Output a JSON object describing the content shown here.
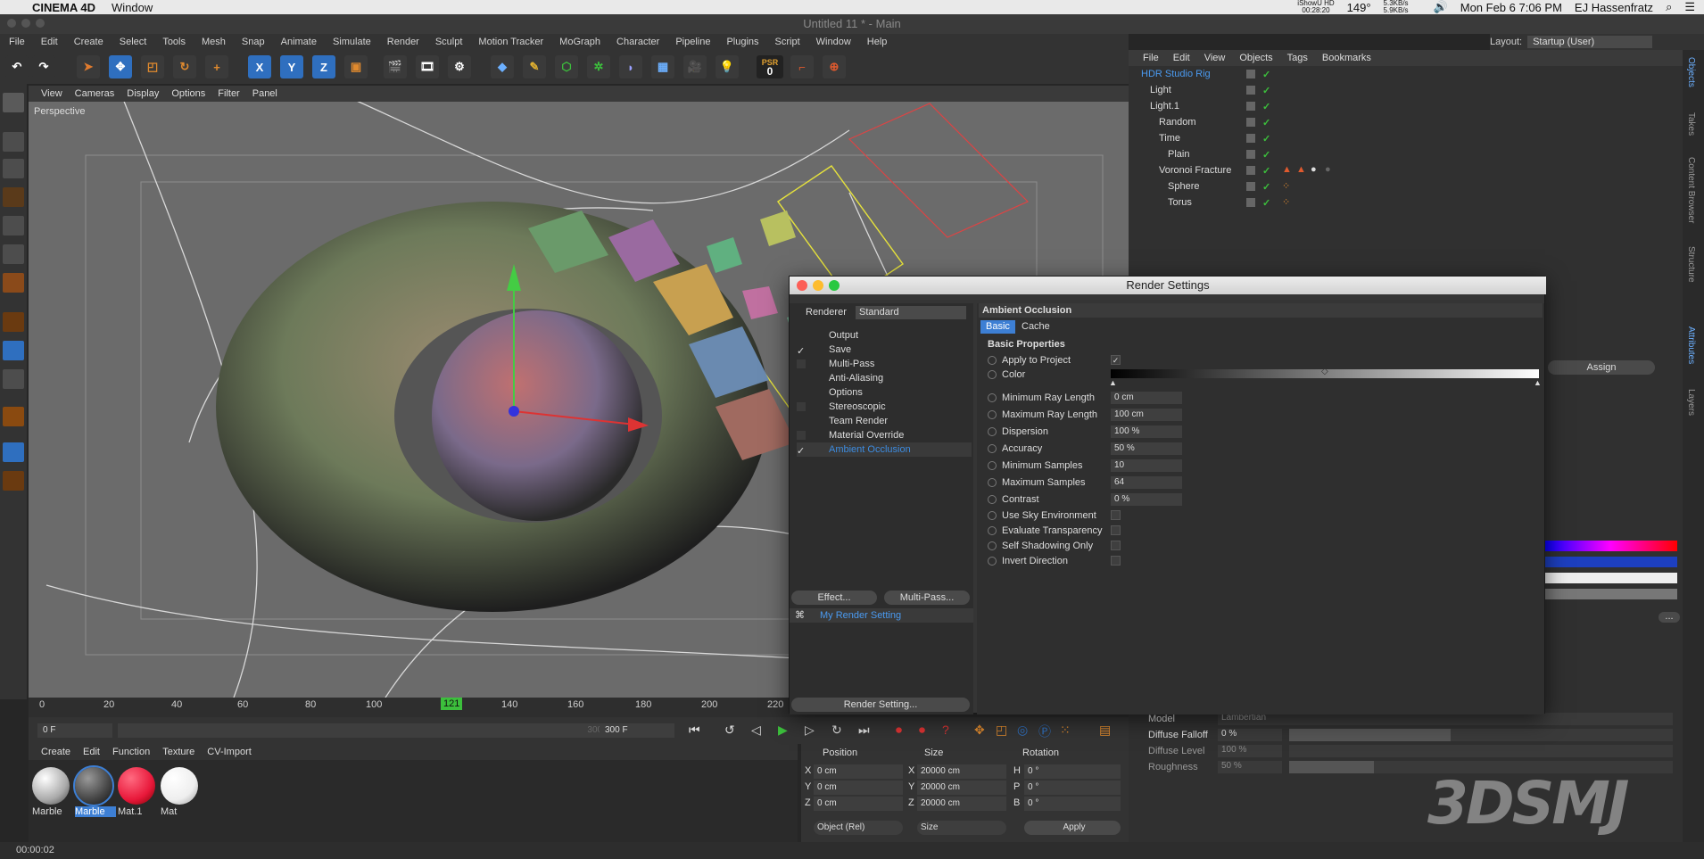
{
  "macbar": {
    "app_name": "CINEMA 4D",
    "window_menu": "Window",
    "ishowu": "iShowU HD",
    "rec_time": "00:28:20",
    "temp": "149°",
    "net_up": "5.3KB/s",
    "net_down": "5.9KB/s",
    "datetime": "Mon Feb 6  7:06 PM",
    "user": "EJ Hassenfratz"
  },
  "window_title": "Untitled 11 * - Main",
  "main_menu": [
    "File",
    "Edit",
    "Create",
    "Select",
    "Tools",
    "Mesh",
    "Snap",
    "Animate",
    "Simulate",
    "Render",
    "Sculpt",
    "Motion Tracker",
    "MoGraph",
    "Character",
    "Pipeline",
    "Plugins",
    "Script",
    "Window",
    "Help"
  ],
  "layout": {
    "label": "Layout:",
    "value": "Startup (User)"
  },
  "toolbar": {
    "x": "X",
    "y": "Y",
    "z": "Z",
    "psr_label": "PSR",
    "psr_value": "0"
  },
  "viewport": {
    "menu": [
      "View",
      "Cameras",
      "Display",
      "Options",
      "Filter",
      "Panel"
    ],
    "label": "Perspective"
  },
  "timeline": {
    "ticks": [
      "0",
      "20",
      "40",
      "60",
      "80",
      "100",
      "121",
      "140",
      "160",
      "180",
      "200",
      "220"
    ],
    "current_frame": "121",
    "start_field": "0 F",
    "end_field": "300 F",
    "slider_text": "300 F"
  },
  "materials": {
    "menu": [
      "Create",
      "Edit",
      "Function",
      "Texture",
      "CV-Import"
    ],
    "items": [
      {
        "label": "Marble",
        "color": "#d9d9d9",
        "selected": false
      },
      {
        "label": "Marble",
        "color": "#555555",
        "selected": true
      },
      {
        "label": "Mat.1",
        "color": "#e8183a",
        "selected": false
      },
      {
        "label": "Mat",
        "color": "#f2f2f2",
        "selected": false
      }
    ]
  },
  "coords": {
    "position_label": "Position",
    "size_label": "Size",
    "rotation_label": "Rotation",
    "rows": [
      {
        "axis": "X",
        "pos": "0 cm",
        "size": "20000 cm",
        "rot_axis": "H",
        "rot": "0 °"
      },
      {
        "axis": "Y",
        "pos": "0 cm",
        "size": "20000 cm",
        "rot_axis": "P",
        "rot": "0 °"
      },
      {
        "axis": "Z",
        "pos": "0 cm",
        "size": "20000 cm",
        "rot_axis": "B",
        "rot": "0 °"
      }
    ],
    "mode": "Object (Rel)",
    "size_mode": "Size",
    "apply": "Apply"
  },
  "status_time": "00:00:02",
  "objects": {
    "menu": [
      "File",
      "Edit",
      "View",
      "Objects",
      "Tags",
      "Bookmarks"
    ],
    "items": [
      {
        "name": "HDR Studio Rig",
        "selected": true
      },
      {
        "name": "Light",
        "selected": false
      },
      {
        "name": "Light.1",
        "selected": false
      },
      {
        "name": "Random",
        "selected": false
      },
      {
        "name": "Time",
        "selected": false
      },
      {
        "name": "Plain",
        "selected": false
      },
      {
        "name": "Voronoi Fracture",
        "selected": false
      },
      {
        "name": "Sphere",
        "selected": false
      },
      {
        "name": "Torus",
        "selected": false
      }
    ]
  },
  "right_tabs": [
    "Objects",
    "Takes",
    "Content Browser",
    "Structure",
    "Attributes",
    "Layers"
  ],
  "attributes": {
    "assign": "Assign",
    "model_label": "Model",
    "model_value": "Lambertian",
    "diffuse_falloff_label": "Diffuse Falloff",
    "diffuse_falloff_value": "0 %",
    "diffuse_level_label": "Diffuse Level",
    "diffuse_level_value": "100 %",
    "roughness_label": "Roughness",
    "roughness_value": "50 %",
    "dots": "..."
  },
  "render_settings": {
    "title": "Render Settings",
    "renderer_label": "Renderer",
    "renderer_value": "Standard",
    "items": [
      {
        "label": "Output",
        "checked": false,
        "has_box": false
      },
      {
        "label": "Save",
        "checked": true,
        "has_box": true
      },
      {
        "label": "Multi-Pass",
        "checked": false,
        "has_box": true
      },
      {
        "label": "Anti-Aliasing",
        "checked": false,
        "has_box": false
      },
      {
        "label": "Options",
        "checked": false,
        "has_box": false
      },
      {
        "label": "Stereoscopic",
        "checked": false,
        "has_box": true
      },
      {
        "label": "Team Render",
        "checked": false,
        "has_box": false
      },
      {
        "label": "Material Override",
        "checked": false,
        "has_box": true
      },
      {
        "label": "Ambient Occlusion",
        "checked": true,
        "has_box": true
      }
    ],
    "effect_btn": "Effect...",
    "multipass_btn": "Multi-Pass...",
    "preset_name": "My Render Setting",
    "render_setting_btn": "Render Setting...",
    "section": "Ambient Occlusion",
    "tabs": [
      "Basic",
      "Cache"
    ],
    "group": "Basic Properties",
    "props": [
      {
        "label": "Apply to Project",
        "type": "check",
        "value": "✓"
      },
      {
        "label": "Color",
        "type": "gradient",
        "value": ""
      },
      {
        "label": "Minimum Ray Length",
        "type": "field",
        "value": "0 cm"
      },
      {
        "label": "Maximum Ray Length",
        "type": "field",
        "value": "100 cm"
      },
      {
        "label": "Dispersion",
        "type": "field",
        "value": "100 %"
      },
      {
        "label": "Accuracy",
        "type": "field",
        "value": "50 %"
      },
      {
        "label": "Minimum Samples",
        "type": "field",
        "value": "10"
      },
      {
        "label": "Maximum Samples",
        "type": "field",
        "value": "64"
      },
      {
        "label": "Contrast",
        "type": "field",
        "value": "0 %"
      },
      {
        "label": "Use Sky Environment",
        "type": "check",
        "value": ""
      },
      {
        "label": "Evaluate Transparency",
        "type": "check",
        "value": ""
      },
      {
        "label": "Self Shadowing Only",
        "type": "check",
        "value": ""
      },
      {
        "label": "Invert Direction",
        "type": "check",
        "value": ""
      }
    ]
  },
  "watermark": "3DSMJ",
  "colors": {
    "accent": "#3d7fd4",
    "selected_text": "#3d8ce0",
    "check_green": "#3cbf3c"
  }
}
